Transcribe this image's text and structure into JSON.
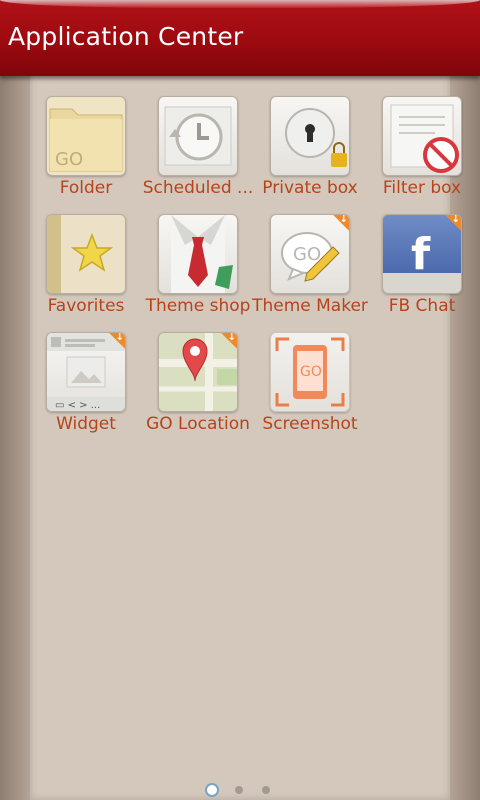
{
  "app": {
    "title": "Application Center"
  },
  "apps": [
    {
      "label": "Folder",
      "icon": "folder-icon"
    },
    {
      "label": "Scheduled ...",
      "icon": "clock-icon"
    },
    {
      "label": "Private box",
      "icon": "lock-icon"
    },
    {
      "label": "Filter box",
      "icon": "filter-icon"
    },
    {
      "label": "Favorites",
      "icon": "star-icon"
    },
    {
      "label": "Theme shop",
      "icon": "tie-icon"
    },
    {
      "label": "Theme Maker",
      "icon": "pencil-icon"
    },
    {
      "label": "FB Chat",
      "icon": "facebook-icon"
    },
    {
      "label": "Widget",
      "icon": "widget-icon"
    },
    {
      "label": "GO Location",
      "icon": "map-pin-icon"
    },
    {
      "label": "Screenshot",
      "icon": "screenshot-icon"
    }
  ],
  "pager": {
    "pages": 3,
    "current": 1
  },
  "colors": {
    "header": "#9c0a0f",
    "label": "#b5441b",
    "panel": "#d4c8bc",
    "badge": "#ee8a2c"
  }
}
